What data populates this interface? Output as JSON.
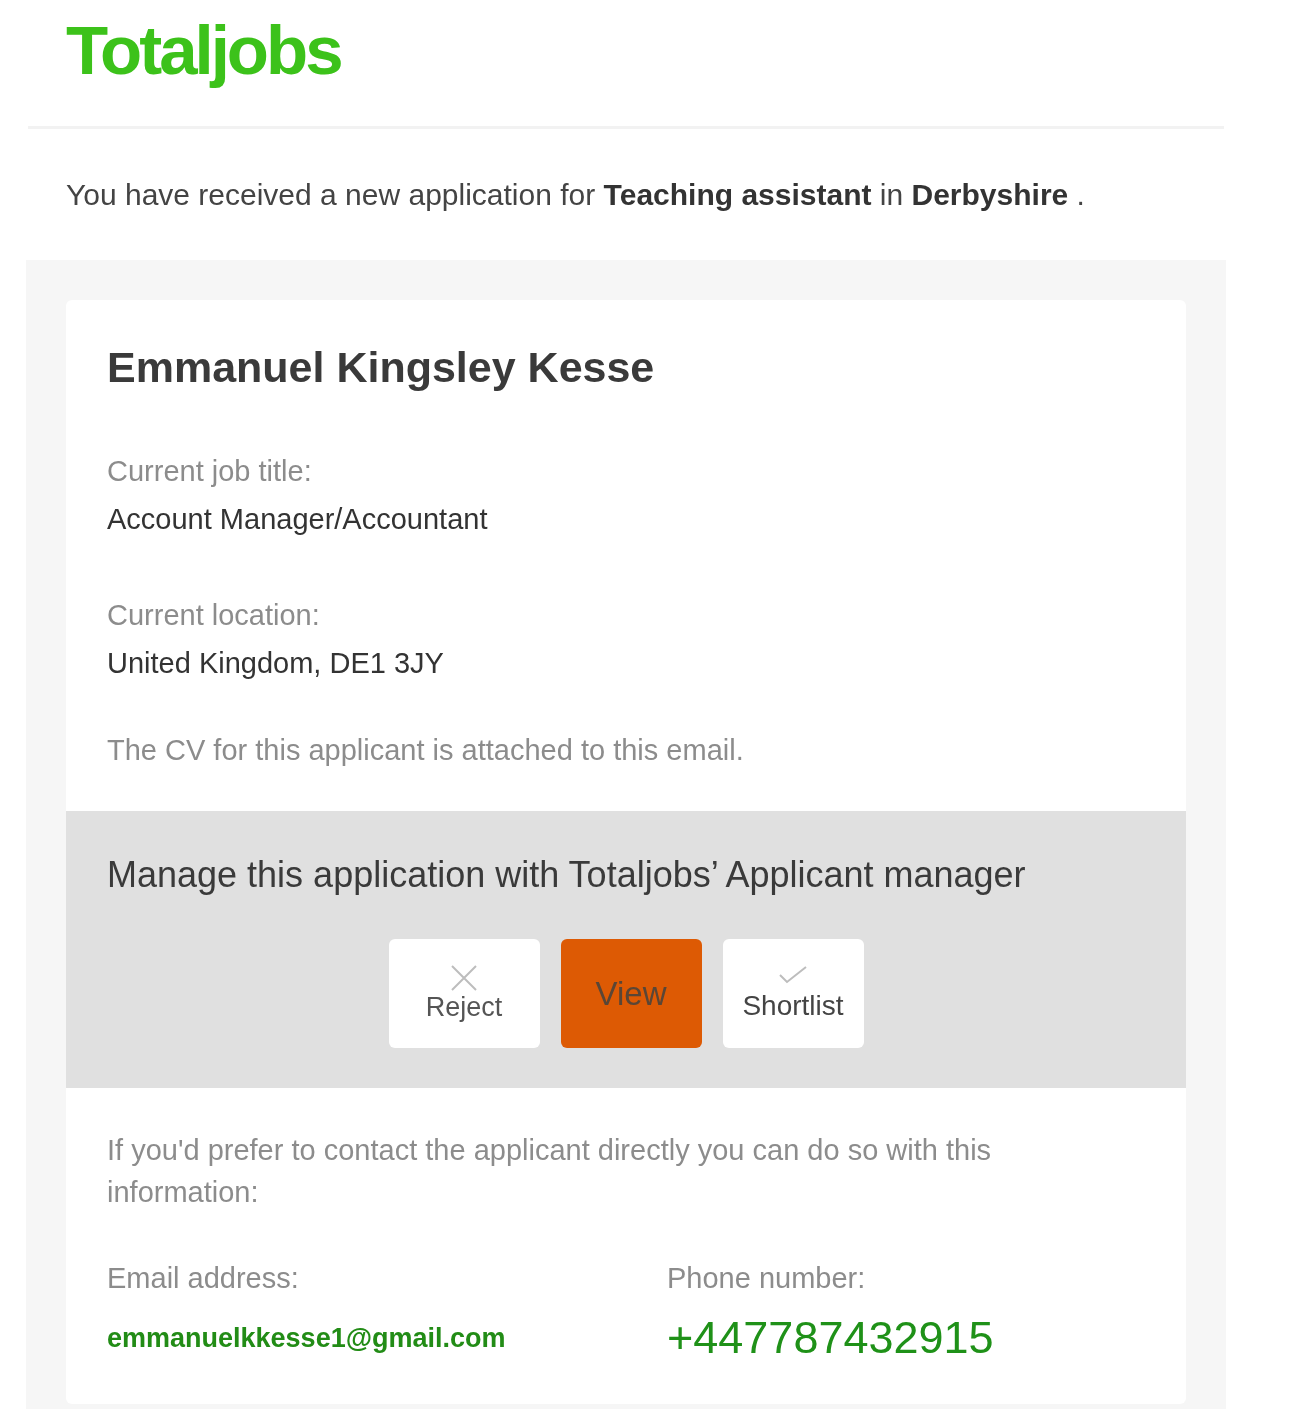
{
  "logo": {
    "text": "Totaljobs"
  },
  "intro": "You have received a new application for **Teaching assistant** in **Derbyshire** .",
  "applicant": {
    "name": "Emmanuel Kingsley Kesse",
    "fields": [
      {
        "label": "Current job title:",
        "value": "Account Manager/Accountant"
      },
      {
        "label": "Current location:",
        "value": "United Kingdom, DE1 3JY"
      }
    ],
    "cv_note": "The CV for this applicant is attached to this email."
  },
  "manage": {
    "heading": "Manage this application with Totaljobs’ Applicant manager",
    "buttons": [
      {
        "kind": "reject",
        "label": "Reject"
      },
      {
        "kind": "view",
        "label": "View"
      },
      {
        "kind": "shortlist",
        "label": "Shortlist"
      }
    ]
  },
  "contact": {
    "intro": "If you'd prefer to contact the applicant directly you can do so with this information:",
    "email": {
      "label": "Email address:",
      "value": "emmanuelkkesse1@gmail.com"
    },
    "phone": {
      "label": "Phone number:",
      "value": "+447787432915"
    }
  }
}
